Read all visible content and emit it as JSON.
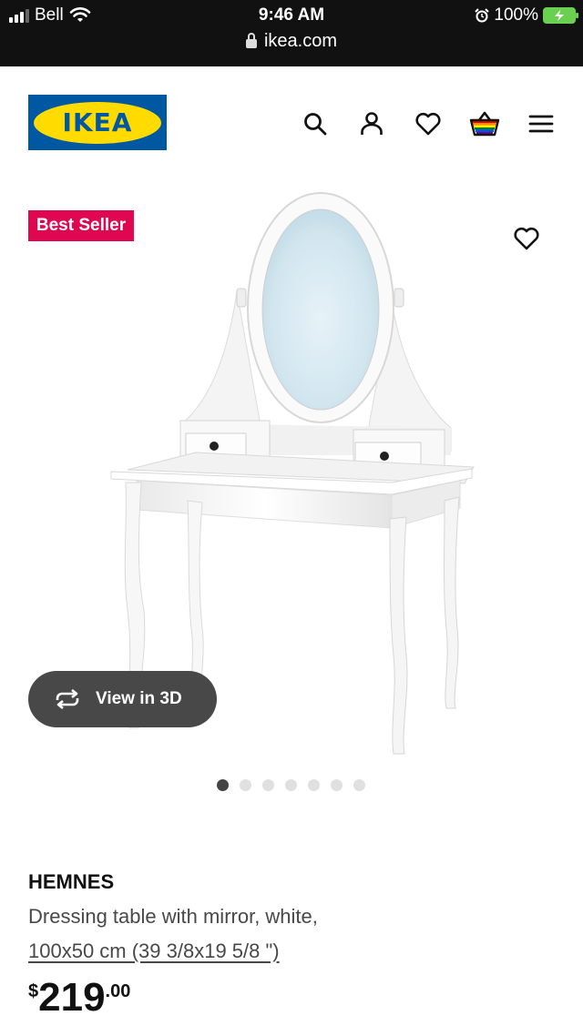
{
  "status_bar": {
    "carrier": "Bell",
    "time": "9:46 AM",
    "battery": "100%",
    "url": "ikea.com"
  },
  "header": {
    "logo_text": "IKEA",
    "icons": [
      "search-icon",
      "account-icon",
      "wishlist-icon",
      "cart-icon",
      "menu-icon"
    ]
  },
  "product": {
    "badge": "Best Seller",
    "view_3d_label": "View in 3D",
    "image_count": 7,
    "active_image": 1,
    "name": "HEMNES",
    "description": "Dressing table with mirror, white,",
    "dimensions": "100x50 cm (39 3/8x19 5/8 \")",
    "price_currency": "$",
    "price_integer": "219",
    "price_decimal": ".00"
  },
  "colors": {
    "ikea_blue": "#0058a3",
    "ikea_yellow": "#ffdb00",
    "badge_red": "#e00751",
    "button_dark": "#484848"
  }
}
